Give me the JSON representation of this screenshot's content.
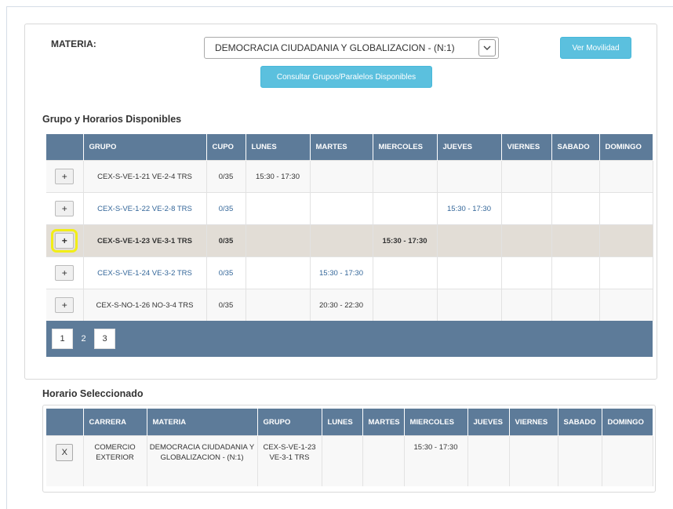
{
  "form": {
    "materia_label": "MATERIA:",
    "materia_selected": "DEMOCRACIA CIUDADANIA Y GLOBALIZACION - (N:1)",
    "ver_movilidad_label": "Ver Movilidad",
    "consultar_label": "Consultar Grupos/Paralelos Disponibles"
  },
  "grupos": {
    "title": "Grupo y Horarios Disponibles",
    "headers": [
      "",
      "GRUPO",
      "CUPO",
      "LUNES",
      "MARTES",
      "MIERCOLES",
      "JUEVES",
      "VIERNES",
      "SABADO",
      "DOMINGO"
    ],
    "add_label": "+",
    "rows": [
      {
        "grupo": "CEX-S-VE-1-21 VE-2-4 TRS",
        "cupo": "0/35",
        "lunes": "15:30 - 17:30",
        "martes": "",
        "miercoles": "",
        "jueves": "",
        "viernes": "",
        "sabado": "",
        "domingo": ""
      },
      {
        "grupo": "CEX-S-VE-1-22 VE-2-8 TRS",
        "cupo": "0/35",
        "lunes": "",
        "martes": "",
        "miercoles": "",
        "jueves": "15:30 - 17:30",
        "viernes": "",
        "sabado": "",
        "domingo": ""
      },
      {
        "grupo": "CEX-S-VE-1-23 VE-3-1 TRS",
        "cupo": "0/35",
        "lunes": "",
        "martes": "",
        "miercoles": "15:30 - 17:30",
        "jueves": "",
        "viernes": "",
        "sabado": "",
        "domingo": ""
      },
      {
        "grupo": "CEX-S-VE-1-24 VE-3-2 TRS",
        "cupo": "0/35",
        "lunes": "",
        "martes": "15:30 - 17:30",
        "miercoles": "",
        "jueves": "",
        "viernes": "",
        "sabado": "",
        "domingo": ""
      },
      {
        "grupo": "CEX-S-NO-1-26 NO-3-4 TRS",
        "cupo": "0/35",
        "lunes": "",
        "martes": "20:30 - 22:30",
        "miercoles": "",
        "jueves": "",
        "viernes": "",
        "sabado": "",
        "domingo": ""
      }
    ],
    "pages": [
      "1",
      "2",
      "3"
    ],
    "active_page": "2"
  },
  "seleccionado": {
    "title": "Horario Seleccionado",
    "headers": [
      "",
      "CARRERA",
      "MATERIA",
      "GRUPO",
      "LUNES",
      "MARTES",
      "MIERCOLES",
      "JUEVES",
      "VIERNES",
      "SABADO",
      "DOMINGO"
    ],
    "remove_label": "X",
    "row": {
      "carrera": "COMERCIO EXTERIOR",
      "materia": "DEMOCRACIA CIUDADANIA Y GLOBALIZACION - (N:1)",
      "grupo": "CEX-S-VE-1-23 VE-3-1 TRS",
      "lunes": "",
      "martes": "",
      "miercoles": "15:30 - 17:30",
      "jueves": "",
      "viernes": "",
      "sabado": "",
      "domingo": ""
    }
  },
  "colors": {
    "header_bg": "#5d7b99",
    "button_blue": "#5bc0de",
    "selected_row": "#e2ddd6",
    "highlight": "#f2ee16"
  }
}
